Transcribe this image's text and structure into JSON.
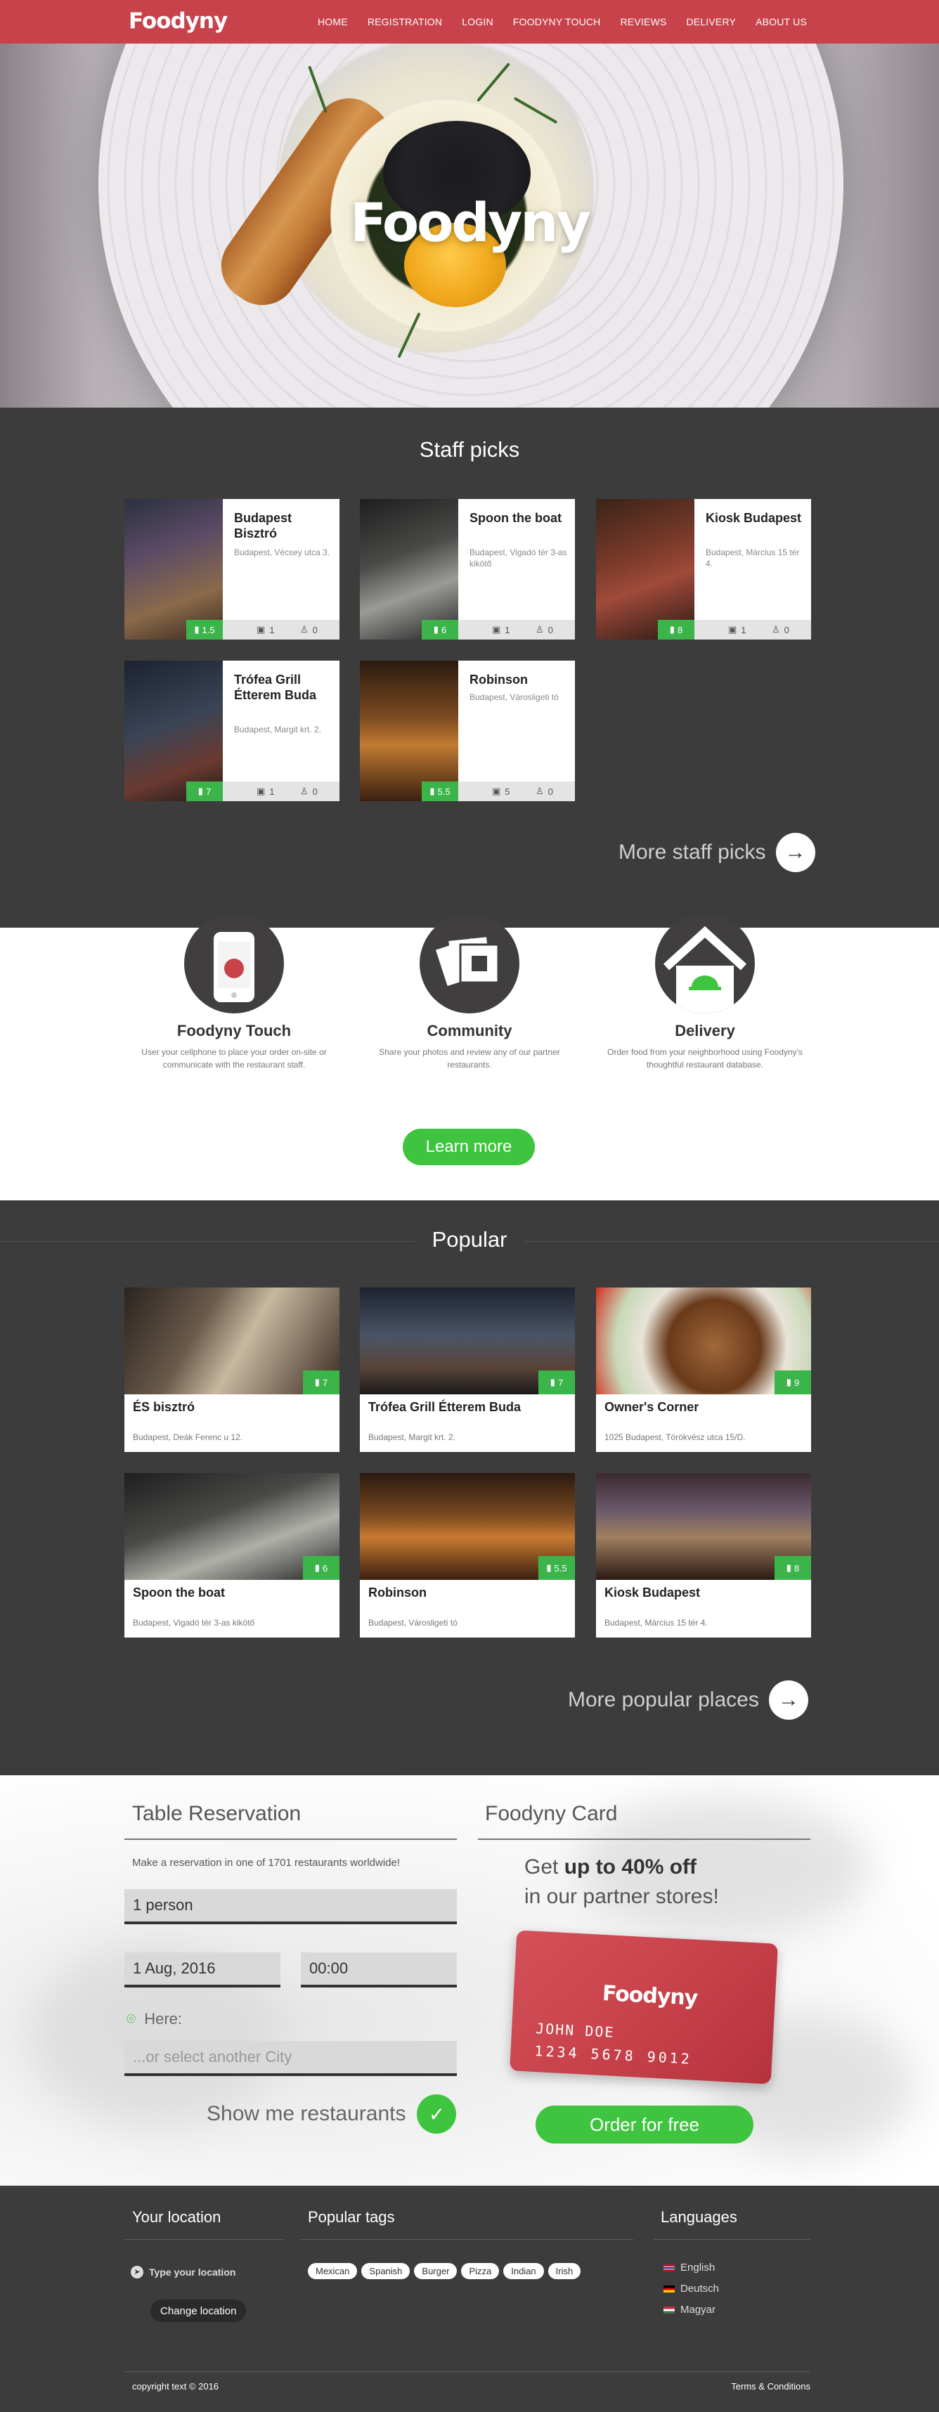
{
  "brand": {
    "logo_text": "Foodyny"
  },
  "nav": {
    "items": [
      "HOME",
      "REGISTRATION",
      "LOGIN",
      "FOODYNY TOUCH",
      "REVIEWS",
      "DELIVERY",
      "ABOUT US"
    ]
  },
  "hero": {
    "logo_text": "Foodyny"
  },
  "staff_picks": {
    "title": "Staff picks",
    "cards": [
      {
        "name": "Budapest Bisztró",
        "address": "Budapest, Vécsey utca 3.",
        "score": "1.5",
        "photos": "1",
        "users": "0"
      },
      {
        "name": "Spoon the boat",
        "address": "Budapest, Vigadó tér 3-as kikötő",
        "score": "6",
        "photos": "1",
        "users": "0"
      },
      {
        "name": "Kiosk Budapest",
        "address": "Budapest, Március 15 tér 4.",
        "score": "8",
        "photos": "1",
        "users": "0"
      },
      {
        "name": "Trófea Grill Étterem Buda",
        "address": "Budapest, Margit krt. 2.",
        "score": "7",
        "photos": "1",
        "users": "0"
      },
      {
        "name": "Robinson",
        "address": "Budapest, Városligeti tó",
        "score": "5.5",
        "photos": "5",
        "users": "0"
      }
    ],
    "more_label": "More staff picks"
  },
  "features": {
    "items": [
      {
        "title": "Foodyny Touch",
        "desc": "User your cellphone to place your order on-site or communicate with the restaurant staff."
      },
      {
        "title": "Community",
        "desc": "Share your photos and review any of our partner restaurants."
      },
      {
        "title": "Delivery",
        "desc": "Order food from your neighborhood using Foodyny's thoughtful restaurant database."
      }
    ],
    "learn_more": "Learn more"
  },
  "popular": {
    "title": "Popular",
    "cards": [
      {
        "name": "ÉS bisztró",
        "address": "Budapest, Deák Ferenc u 12.",
        "score": "7"
      },
      {
        "name": "Trófea Grill Étterem Buda",
        "address": "Budapest, Margit krt. 2.",
        "score": "7"
      },
      {
        "name": "Owner's Corner",
        "address": "1025 Budapest, Törökvész utca 15/D.",
        "score": "9"
      },
      {
        "name": "Spoon the boat",
        "address": "Budapest, Vigadó tér 3-as kikötő",
        "score": "6"
      },
      {
        "name": "Robinson",
        "address": "Budapest, Városligeti tó",
        "score": "5.5"
      },
      {
        "name": "Kiosk Budapest",
        "address": "Budapest, Március 15 tér 4.",
        "score": "8"
      }
    ],
    "more_label": "More popular places"
  },
  "reservation": {
    "title": "Table Reservation",
    "subtitle": "Make a reservation in one of 1701 restaurants worldwide!",
    "persons": "1 person",
    "date": "1 Aug, 2016",
    "time": "00:00",
    "here_label": "Here:",
    "city_placeholder": "...or select another City",
    "show_label": "Show me restaurants"
  },
  "card": {
    "title": "Foodyny Card",
    "promo_prefix": "Get ",
    "promo_bold": "up to 40% off",
    "promo_line2": "in our partner stores!",
    "card_logo": "Foodyny",
    "card_name": "JOHN DOE",
    "card_number": "1234 5678 9012",
    "order_label": "Order for free"
  },
  "footer": {
    "location_title": "Your location",
    "location_placeholder": "Type your location",
    "change_location": "Change location",
    "tags_title": "Popular tags",
    "tags": [
      "Mexican",
      "Spanish",
      "Burger",
      "Pizza",
      "Indian",
      "Irish"
    ],
    "languages_title": "Languages",
    "languages": [
      "English",
      "Deutsch",
      "Magyar"
    ],
    "copyright": "copyright text © 2016",
    "terms": "Terms & Conditions"
  },
  "colors": {
    "brand_red": "#c8424b",
    "accent_green": "#3ec43e",
    "score_green": "#3bb54a",
    "dark_bg": "#3d3c3d"
  }
}
